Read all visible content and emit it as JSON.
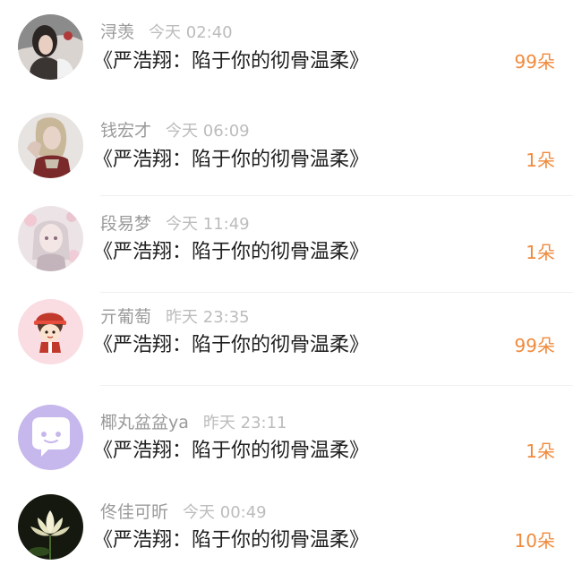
{
  "colors": {
    "username": "#9a9a9a",
    "time": "#bcbcbc",
    "title": "#1f1f1f",
    "count_accent": "#f08a3c"
  },
  "list": {
    "items": [
      {
        "username": "浔羡",
        "time": "今天 02:40",
        "title": "《严浩翔：陷于你的彻骨温柔》",
        "count": "99朵",
        "avatar": "girl-photo-avatar"
      },
      {
        "username": "钱宏才",
        "time": "今天 06:09",
        "title": "《严浩翔：陷于你的彻骨温柔》",
        "count": "1朵",
        "avatar": "blonde-photo-avatar"
      },
      {
        "username": "段易梦",
        "time": "今天 11:49",
        "title": "《严浩翔：陷于你的彻骨温柔》",
        "count": "1朵",
        "avatar": "anime-girl-avatar"
      },
      {
        "username": "亓葡萄",
        "time": "昨天 23:35",
        "title": "《严浩翔：陷于你的彻骨温柔》",
        "count": "99朵",
        "avatar": "cartoon-character-avatar"
      },
      {
        "username": "椰丸盆盆ya",
        "time": "昨天 23:11",
        "title": "《严浩翔：陷于你的彻骨温柔》",
        "count": "1朵",
        "avatar": "chat-bubble-avatar"
      },
      {
        "username": "佟佳可昕",
        "time": "今天 00:49",
        "title": "《严浩翔：陷于你的彻骨温柔》",
        "count": "10朵",
        "avatar": "lotus-flower-avatar"
      }
    ]
  }
}
